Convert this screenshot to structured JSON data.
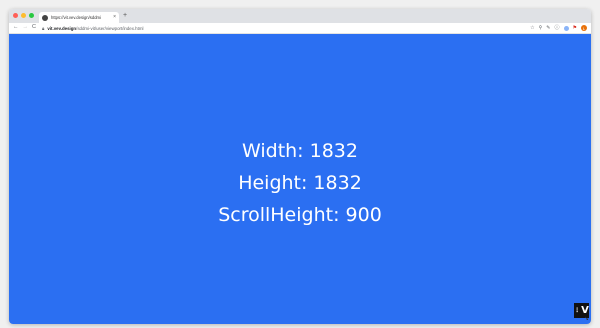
{
  "colors": {
    "page_bg": "#2b6ff2",
    "close_light": "#ff5f57",
    "minimize_light": "#febc2e",
    "maximize_light": "#28c840"
  },
  "browser": {
    "tab": {
      "title": "https://vit.vev.design/sddmi",
      "close_icon": "close-icon",
      "favicon": "globe-icon"
    },
    "new_tab_label": "+",
    "url": {
      "host": "vit.vev.design",
      "path": "/sddmi-vit/user/viewport/index.html"
    },
    "nav": {
      "back": "←",
      "forward": "→",
      "reload": "C"
    },
    "toolbar_icons": [
      "star-icon",
      "pin-icon",
      "extensions-icon",
      "info-icon",
      "settings-icon",
      "flag-icon"
    ],
    "avatar_initial": "L"
  },
  "content": {
    "width_text": "Width: 1832",
    "height_text": "Height: 1832",
    "scroll_height_text": "ScrollHeight: 900"
  },
  "badge": {
    "label": "V"
  }
}
